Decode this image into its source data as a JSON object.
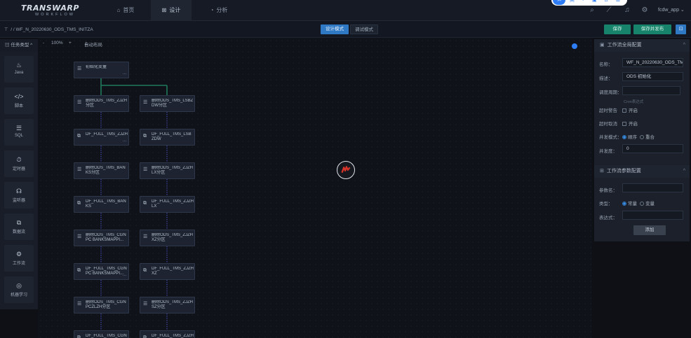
{
  "app": {
    "logo_main": "TRANSWARP",
    "logo_sub": "WORKFLOW",
    "nav_tabs": [
      {
        "label": "首页",
        "icon": "home-icon"
      },
      {
        "label": "设计",
        "icon": "design-icon"
      },
      {
        "label": "分析",
        "icon": "analysis-icon"
      }
    ],
    "user": "fcdw_app",
    "float_toolbar": {
      "badge": "拍",
      "item": "英"
    }
  },
  "subbar": {
    "breadcrumb": "/  /  WF_N_20220630_ODS_TMS_INITZA",
    "mode_design": "设计模式",
    "mode_debug": "调试模式",
    "save": "保存",
    "save_publish": "保存并发布"
  },
  "tasks": {
    "header": "任务类型",
    "items": [
      {
        "label": "Java",
        "icon": "java-icon",
        "glyph": "♨"
      },
      {
        "label": "脚本",
        "icon": "script-icon",
        "glyph": "</>"
      },
      {
        "label": "SQL",
        "icon": "sql-icon",
        "glyph": "☰"
      },
      {
        "label": "定时器",
        "icon": "timer-icon",
        "glyph": "⏱"
      },
      {
        "label": "监听器",
        "icon": "listener-icon",
        "glyph": "☊"
      },
      {
        "label": "数据流",
        "icon": "dataflow-icon",
        "glyph": "⧉"
      },
      {
        "label": "工作流",
        "icon": "workflow-icon",
        "glyph": "⚙"
      },
      {
        "label": "机器学习",
        "icon": "ml-icon",
        "glyph": "◎"
      }
    ]
  },
  "canvas": {
    "zoom_minus": "-",
    "zoom": "100%",
    "zoom_plus": "+",
    "auto_layout": "自动布局",
    "nodes": [
      {
        "title": "初始化变量",
        "kind": "sql",
        "col": 0,
        "row": 0
      },
      {
        "title": "删除ODS_TMS_ZJZH分区",
        "kind": "sql",
        "col": 0,
        "row": 1
      },
      {
        "title": "删除ODS_TMS_LSBZDW分区",
        "kind": "sql",
        "col": 1,
        "row": 1
      },
      {
        "title": "DF_FULL_TMS_ZJZH",
        "kind": "dataflow",
        "col": 0,
        "row": 2
      },
      {
        "title": "DF_FULL_TMS_LSBZDW",
        "kind": "dataflow",
        "col": 1,
        "row": 2
      },
      {
        "title": "删除ODS_TMS_BANKS分区",
        "kind": "sql",
        "col": 0,
        "row": 3
      },
      {
        "title": "删除ODS_TMS_ZJZHLX分区",
        "kind": "sql",
        "col": 1,
        "row": 3
      },
      {
        "title": "DF_FULL_TMS_BANKS",
        "kind": "dataflow",
        "col": 0,
        "row": 4
      },
      {
        "title": "DF_FULL_TMS_ZJZHLX",
        "kind": "dataflow",
        "col": 1,
        "row": 4
      },
      {
        "title": "删除ODS_TMS_CGNPC BANKSMAPPI...",
        "kind": "sql",
        "col": 0,
        "row": 5
      },
      {
        "title": "删除ODS_TMS_ZJZHXZ分区",
        "kind": "sql",
        "col": 1,
        "row": 5
      },
      {
        "title": "DF_FULL_TMS_CGNPC BANKSMAPPI...",
        "kind": "dataflow",
        "col": 0,
        "row": 6
      },
      {
        "title": "DF_FULL_TMS_ZJZHXZ",
        "kind": "dataflow",
        "col": 1,
        "row": 6
      },
      {
        "title": "删除ODS_TMS_CGNPCZLZH分区",
        "kind": "sql",
        "col": 0,
        "row": 7
      },
      {
        "title": "删除ODS_TMS_ZJZHSZ分区",
        "kind": "sql",
        "col": 1,
        "row": 7
      },
      {
        "title": "DF_FULL_TMS_CGN",
        "kind": "dataflow",
        "col": 0,
        "row": 8
      },
      {
        "title": "DF_FULL_TMS_ZJZH",
        "kind": "dataflow",
        "col": 1,
        "row": 8
      }
    ]
  },
  "global_config": {
    "header": "工作流全局配置",
    "name_label": "名称：",
    "name_value": "WF_N_20220630_ODS_TMS_INITZA",
    "desc_label": "描述：",
    "desc_value": "ODS 初始化",
    "schedule_label": "调度周期：",
    "schedule_value": "",
    "schedule_hint": "Cron表达式",
    "timeout_alarm_label": "超时警告",
    "timeout_alarm_opt": "开启",
    "timeout_cancel_label": "超时取消",
    "timeout_cancel_opt": "开启",
    "concurrency_label": "并发模式：",
    "concurrency_opts": [
      "顺序",
      "重合"
    ],
    "parallel_label": "并发度：",
    "parallel_value": "0"
  },
  "param_config": {
    "header": "工作流参数配置",
    "param_name_label": "参数名：",
    "type_label": "类型：",
    "type_opts": [
      "常量",
      "变量"
    ],
    "expr_label": "表达式：",
    "add": "添加"
  },
  "colors": {
    "accent": "#2f79c4",
    "save": "#17836a",
    "edge": "#1f7a5a",
    "edge_dash": "#3a3f8f"
  }
}
